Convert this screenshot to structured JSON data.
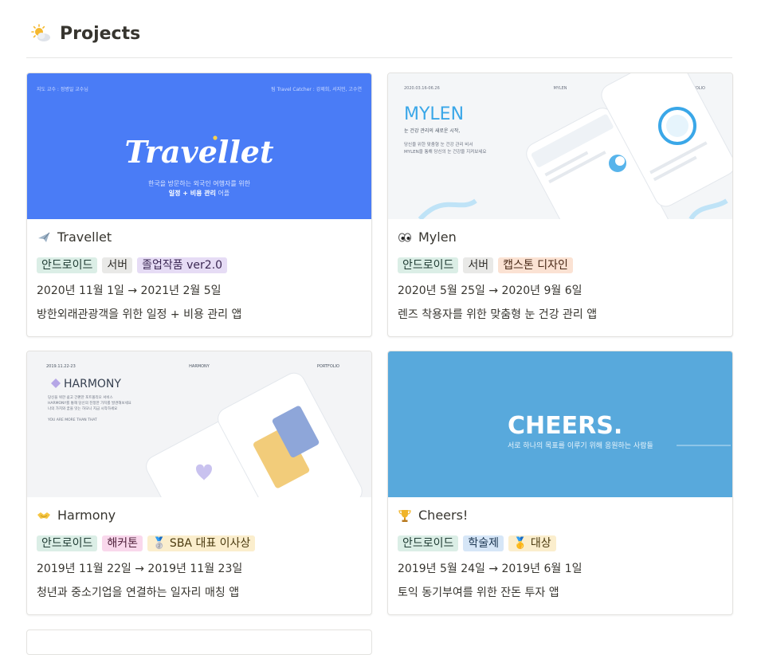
{
  "header": {
    "title": "Projects",
    "icon": "sun-behind-cloud-icon"
  },
  "cards": [
    {
      "title": "Travellet",
      "icon": "airplane-icon",
      "tags": [
        {
          "label": "안드로이드",
          "bg": "#dbeee6",
          "fg": "#1f3b33"
        },
        {
          "label": "서버",
          "bg": "#e9e9e7",
          "fg": "#32302c"
        },
        {
          "label": "졸업작품 ver2.0",
          "bg": "#e6dcf5",
          "fg": "#3b2753"
        }
      ],
      "date": "2020년 11월 1일 → 2021년 2월 5일",
      "desc": "방한외래관광객을 위한 일정 + 비용 관리 앱",
      "cover": {
        "bg": "#4a7cf6",
        "topleft": "지도 교수 : 정병일 교수님",
        "topright": "팀 Travel Catcher : 강제희, 서지민, 고수연",
        "logo": "Travellet",
        "sub1": "한국을 방문하는 외국인 여행자를 위한",
        "sub2": "일정 + 비용 관리",
        "sub3": " 어플"
      }
    },
    {
      "title": "Mylen",
      "icon": "eyes-icon",
      "tags": [
        {
          "label": "안드로이드",
          "bg": "#dbeee6",
          "fg": "#1f3b33"
        },
        {
          "label": "서버",
          "bg": "#e9e9e7",
          "fg": "#32302c"
        },
        {
          "label": "캡스톤 디자인",
          "bg": "#fbe2d3",
          "fg": "#4a2a18"
        }
      ],
      "date": "2020년 5월 25일 → 2020년 9월 6일",
      "desc": "렌즈 착용자를 위한 맞춤형 눈 건강 관리 앱",
      "cover": {
        "bg": "#f4f6f8",
        "topleft": "2020.03.16-06.26",
        "topmid": "MYLEN",
        "topright": "PORTFOLIO",
        "logo": "MYLEN",
        "line1": "눈 건강 관리의 새로운 시작,",
        "line2": "당신을 위한 맞춤형 눈 건강 관리 비서",
        "line3": "MYLEN을 통해 당신의 눈 건강을 지켜보세요"
      }
    },
    {
      "title": "Harmony",
      "icon": "handshake-icon",
      "tags": [
        {
          "label": "안드로이드",
          "bg": "#dbeee6",
          "fg": "#1f3b33"
        },
        {
          "label": "해커톤",
          "bg": "#f9d8ec",
          "fg": "#4f1f3a"
        },
        {
          "label": "🥈 SBA 대표 이사상",
          "bg": "#fbeecd",
          "fg": "#4a3a10"
        }
      ],
      "date": "2019년 11월 22일 → 2019년 11월 23일",
      "desc": "청년과 중소기업을 연결하는 일자리 매칭 앱",
      "cover": {
        "bg": "#f3f4f6",
        "topleft": "2019.11.22-23",
        "topmid": "HARMONY",
        "topright": "PORTFOLIO",
        "logo": "HARMONY",
        "line1": "당신을 위한 쉽고 간편한 포트폴리오 서비스",
        "line2": "HARMONY를 통해 당신의 진정한 가치를 발견해보세요",
        "line3": "나의 가치와 꿈을 잇는 하모니 지금 시작하세요",
        "line4": "YOU ARE MORE THAN THAT"
      }
    },
    {
      "title": "Cheers!",
      "icon": "trophy-icon",
      "tags": [
        {
          "label": "안드로이드",
          "bg": "#dbeee6",
          "fg": "#1f3b33"
        },
        {
          "label": "학술제",
          "bg": "#d6e6f7",
          "fg": "#1b3550"
        },
        {
          "label": "🥇 대상",
          "bg": "#fbeecd",
          "fg": "#4a3a10"
        }
      ],
      "date": "2019년 5월 24일 → 2019년 6월 1일",
      "desc": "토익 동기부여를 위한 잔돈 투자 앱",
      "cover": {
        "bg": "#58a9dc",
        "logo": "CHEERS.",
        "sub": "서로 하나의 목표를 이루기 위해 응원하는 사람들"
      }
    }
  ]
}
